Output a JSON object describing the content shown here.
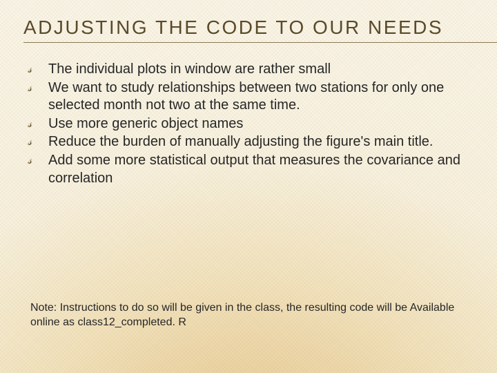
{
  "title": "ADJUSTING THE CODE TO OUR NEEDS",
  "bullets": [
    "The individual plots in window are rather small",
    "We want to study relationships between two stations for only one selected month not two at the same time.",
    "Use more generic object names",
    "Reduce the burden of manually adjusting\nthe figure's main title.",
    "Add some more statistical output that measures the covariance and correlation"
  ],
  "note": "Note: Instructions to do so will be given in the class, the resulting code will be\nAvailable online as class12_completed. R"
}
